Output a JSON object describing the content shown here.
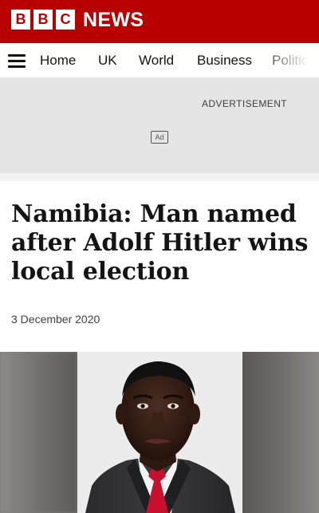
{
  "masthead": {
    "logo_letters": [
      "B",
      "B",
      "C"
    ],
    "brand_word": "NEWS",
    "brand_color": "#b80000"
  },
  "nav": {
    "menu_icon": "hamburger-menu-icon",
    "items": [
      "Home",
      "UK",
      "World",
      "Business",
      "Politics"
    ]
  },
  "ad": {
    "label": "ADVERTISEMENT",
    "badge": "Ad"
  },
  "article": {
    "headline": "Namibia: Man named after Adolf Hitler wins local election",
    "date": "3 December 2020"
  }
}
